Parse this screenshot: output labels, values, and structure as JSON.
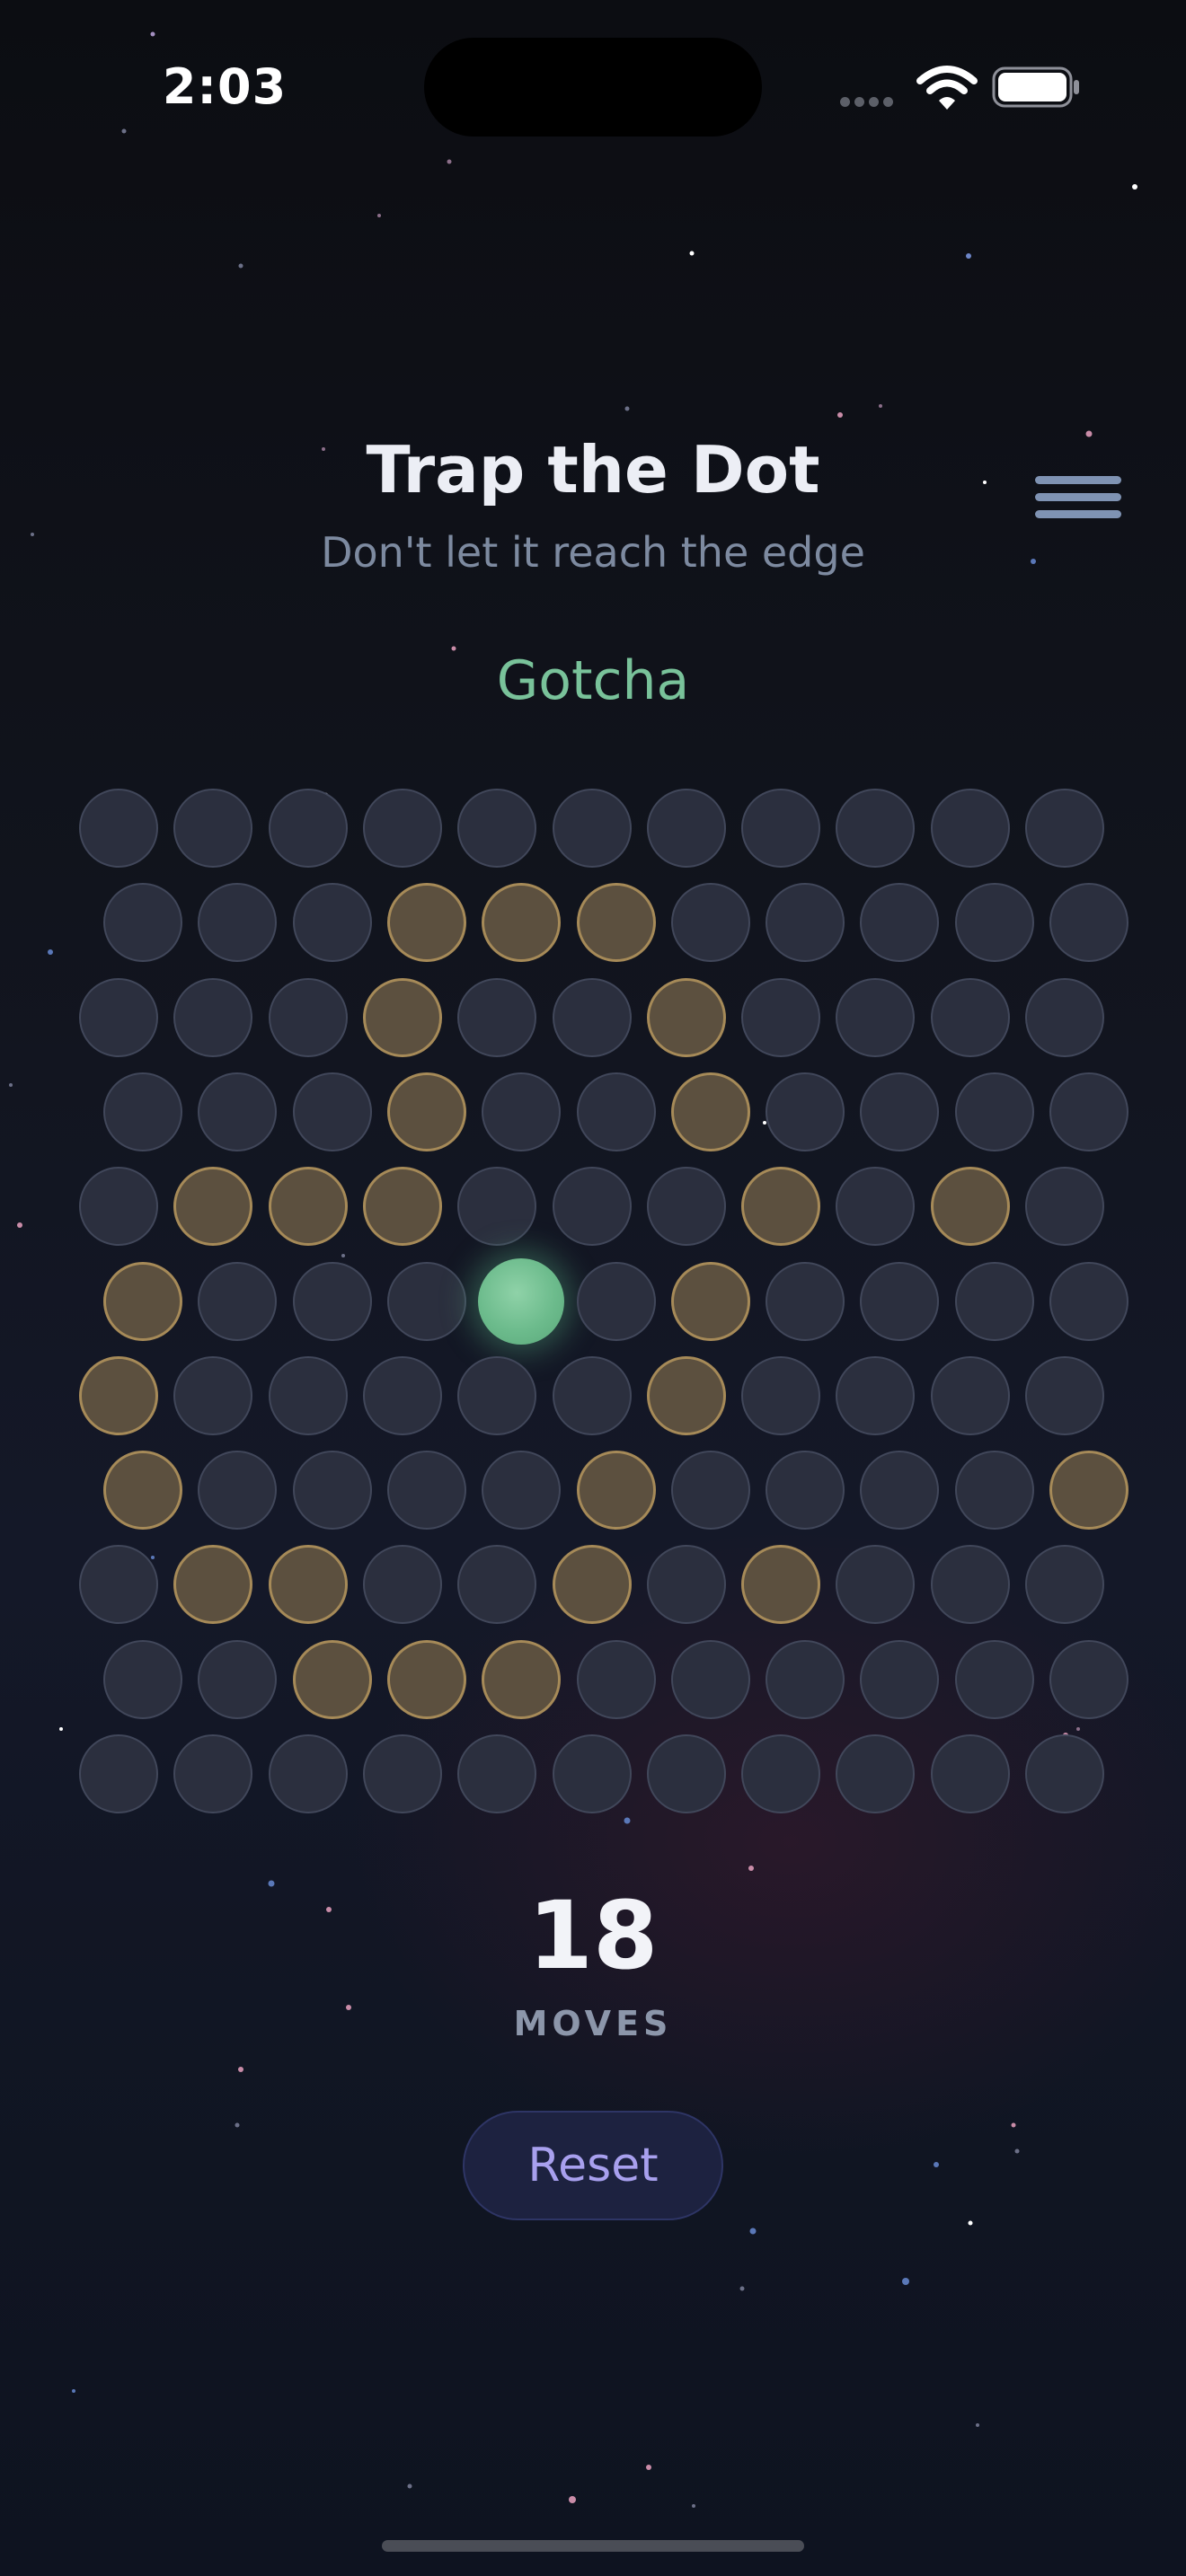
{
  "status_bar": {
    "time": "2:03"
  },
  "header": {
    "title": "Trap the Dot",
    "subtitle": "Don't let it reach the edge"
  },
  "game": {
    "status": "Gotcha",
    "moves": "18",
    "moves_label": "MOVES",
    "board": {
      "rows": 11,
      "cols": 11,
      "walls": [
        [
          1,
          3
        ],
        [
          1,
          4
        ],
        [
          1,
          5
        ],
        [
          2,
          3
        ],
        [
          2,
          6
        ],
        [
          3,
          3
        ],
        [
          3,
          6
        ],
        [
          4,
          1
        ],
        [
          4,
          2
        ],
        [
          4,
          3
        ],
        [
          4,
          7
        ],
        [
          4,
          9
        ],
        [
          5,
          0
        ],
        [
          5,
          6
        ],
        [
          6,
          0
        ],
        [
          6,
          6
        ],
        [
          7,
          0
        ],
        [
          7,
          5
        ],
        [
          7,
          10
        ],
        [
          8,
          1
        ],
        [
          8,
          2
        ],
        [
          8,
          5
        ],
        [
          8,
          7
        ],
        [
          9,
          2
        ],
        [
          9,
          3
        ],
        [
          9,
          4
        ]
      ],
      "dot": [
        5,
        4
      ]
    }
  },
  "controls": {
    "reset_label": "Reset"
  },
  "colors": {
    "dot": "#6cbb8c",
    "wall": "#a68a58",
    "empty_cell": "#2b2f3e",
    "status_text": "#79c29a",
    "reset_text": "#a8a0ee"
  },
  "icons": {
    "menu": "hamburger-icon",
    "wifi": "wifi-icon",
    "battery": "battery-icon",
    "signal": "cellular-signal-icon"
  }
}
